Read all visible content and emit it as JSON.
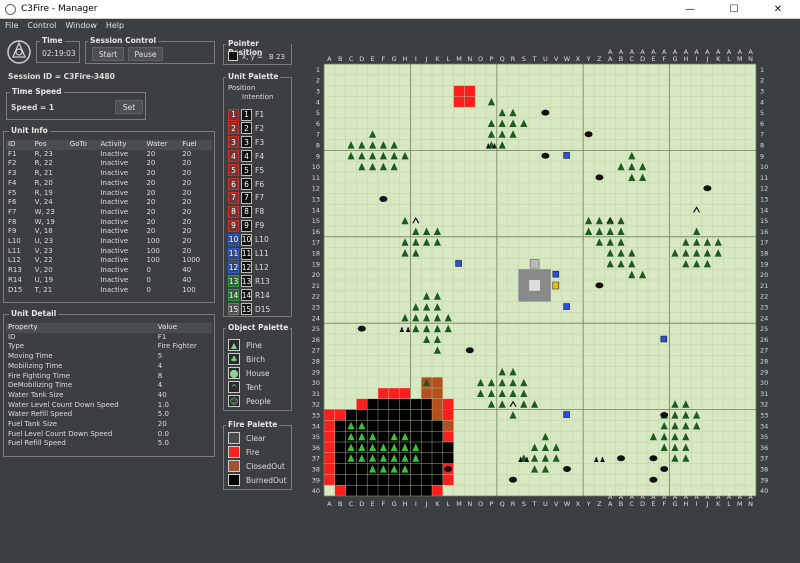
{
  "window": {
    "title": "C3Fire - Manager",
    "minimize": "—",
    "maximize": "☐",
    "close": "✕"
  },
  "menu": [
    "File",
    "Control",
    "Window",
    "Help"
  ],
  "time": {
    "title": "Time",
    "value": "02:19:03"
  },
  "session_control": {
    "title": "Session Control",
    "start": "Start",
    "pause": "Pause"
  },
  "session_id": "Session ID = C3Fire-3480",
  "time_speed": {
    "title": "Time Speed",
    "speed": "Speed = 1",
    "set": "Set"
  },
  "unit_info": {
    "title": "Unit Info",
    "columns": [
      "ID",
      "Pos",
      "GoTo",
      "Activity",
      "Water",
      "Fuel"
    ],
    "rows": [
      [
        "F1",
        "R, 23",
        "",
        "Inactive",
        "20",
        "20"
      ],
      [
        "F2",
        "R, 22",
        "",
        "Inactive",
        "20",
        "20"
      ],
      [
        "F3",
        "R, 21",
        "",
        "Inactive",
        "20",
        "20"
      ],
      [
        "F4",
        "R, 20",
        "",
        "Inactive",
        "20",
        "20"
      ],
      [
        "F5",
        "R, 19",
        "",
        "Inactive",
        "20",
        "20"
      ],
      [
        "F6",
        "V, 24",
        "",
        "Inactive",
        "20",
        "20"
      ],
      [
        "F7",
        "W, 23",
        "",
        "Inactive",
        "20",
        "20"
      ],
      [
        "F8",
        "W, 19",
        "",
        "Inactive",
        "20",
        "20"
      ],
      [
        "F9",
        "V, 18",
        "",
        "Inactive",
        "20",
        "20"
      ],
      [
        "L10",
        "U, 23",
        "",
        "Inactive",
        "100",
        "20"
      ],
      [
        "L11",
        "V, 23",
        "",
        "Inactive",
        "100",
        "20"
      ],
      [
        "L12",
        "V, 22",
        "",
        "Inactive",
        "100",
        "1000"
      ],
      [
        "R13",
        "V, 20",
        "",
        "Inactive",
        "0",
        "40"
      ],
      [
        "R14",
        "U, 19",
        "",
        "Inactive",
        "0",
        "40"
      ],
      [
        "D15",
        "T, 21",
        "",
        "Inactive",
        "0",
        "100"
      ]
    ]
  },
  "unit_detail": {
    "title": "Unit Detail",
    "columns": [
      "Property",
      "Value"
    ],
    "rows": [
      [
        "ID",
        "F1"
      ],
      [
        "Type",
        "Fire Fighter"
      ],
      [
        "Moving Time",
        "5"
      ],
      [
        "Mobilizing Time",
        "4"
      ],
      [
        "Fire Fighting Time",
        "8"
      ],
      [
        "DeMobilizing Time",
        "4"
      ],
      [
        "Water Tank Size",
        "40"
      ],
      [
        "Water Level Count Down Speed",
        "1.0"
      ],
      [
        "Water Refill Speed",
        "5.0"
      ],
      [
        "Fuel Tank Size",
        "20"
      ],
      [
        "Fuel Level Count Down Speed",
        "0.0"
      ],
      [
        "Fuel Refill Speed",
        "5.0"
      ]
    ]
  },
  "pointer_position": {
    "title": "Pointer Position",
    "value": "x, y =",
    "coord": "B 23"
  },
  "unit_palette": {
    "title": "Unit Palette",
    "col1": "Position",
    "col2": "Intention",
    "units": [
      {
        "n": "1",
        "id": "F1",
        "c": "#d32a2a"
      },
      {
        "n": "2",
        "id": "F2",
        "c": "#d32a2a"
      },
      {
        "n": "3",
        "id": "F3",
        "c": "#d32a2a"
      },
      {
        "n": "4",
        "id": "F4",
        "c": "#d32a2a"
      },
      {
        "n": "5",
        "id": "F5",
        "c": "#d32a2a"
      },
      {
        "n": "6",
        "id": "F6",
        "c": "#d32a2a"
      },
      {
        "n": "7",
        "id": "F7",
        "c": "#d32a2a"
      },
      {
        "n": "8",
        "id": "F8",
        "c": "#d32a2a"
      },
      {
        "n": "9",
        "id": "F9",
        "c": "#d32a2a"
      },
      {
        "n": "10",
        "id": "L10",
        "c": "#2a5ad3"
      },
      {
        "n": "11",
        "id": "L11",
        "c": "#2a5ad3"
      },
      {
        "n": "12",
        "id": "L12",
        "c": "#2a5ad3"
      },
      {
        "n": "13",
        "id": "R13",
        "c": "#2a9a3a"
      },
      {
        "n": "14",
        "id": "R14",
        "c": "#2a9a3a"
      },
      {
        "n": "15",
        "id": "D15",
        "c": "#777777"
      }
    ]
  },
  "object_palette": {
    "title": "Object Palette",
    "items": [
      {
        "label": "Pine",
        "icon": "pine-icon"
      },
      {
        "label": "Birch",
        "icon": "birch-icon"
      },
      {
        "label": "House",
        "icon": "house-icon"
      },
      {
        "label": "Tent",
        "icon": "tent-icon"
      },
      {
        "label": "People",
        "icon": "people-icon"
      }
    ]
  },
  "fire_palette": {
    "title": "Fire Palette",
    "items": [
      {
        "label": "Clear",
        "color": "#4a4a4a"
      },
      {
        "label": "Fire",
        "color": "#ff2020"
      },
      {
        "label": "ClosedOut",
        "color": "#a0522d"
      },
      {
        "label": "BurnedOut",
        "color": "#000000"
      }
    ]
  },
  "map": {
    "columns": [
      "A",
      "B",
      "C",
      "D",
      "E",
      "F",
      "G",
      "H",
      "I",
      "J",
      "K",
      "L",
      "M",
      "N",
      "O",
      "P",
      "Q",
      "R",
      "S",
      "T",
      "U",
      "V",
      "W",
      "X",
      "Y",
      "Z",
      "AA",
      "AB",
      "AC",
      "AD",
      "AE",
      "AF",
      "AG",
      "AH",
      "AI",
      "AJ",
      "AK",
      "AL",
      "AM",
      "AN"
    ],
    "rows": 40,
    "colors": {
      "ground": "#d7e8c2",
      "grid": "#b9cfa3",
      "major": "#6e8060",
      "pine": "#1e5a1e",
      "fire": "#ff1e1e",
      "burned": "#000000",
      "closed": "#b4501e"
    }
  }
}
